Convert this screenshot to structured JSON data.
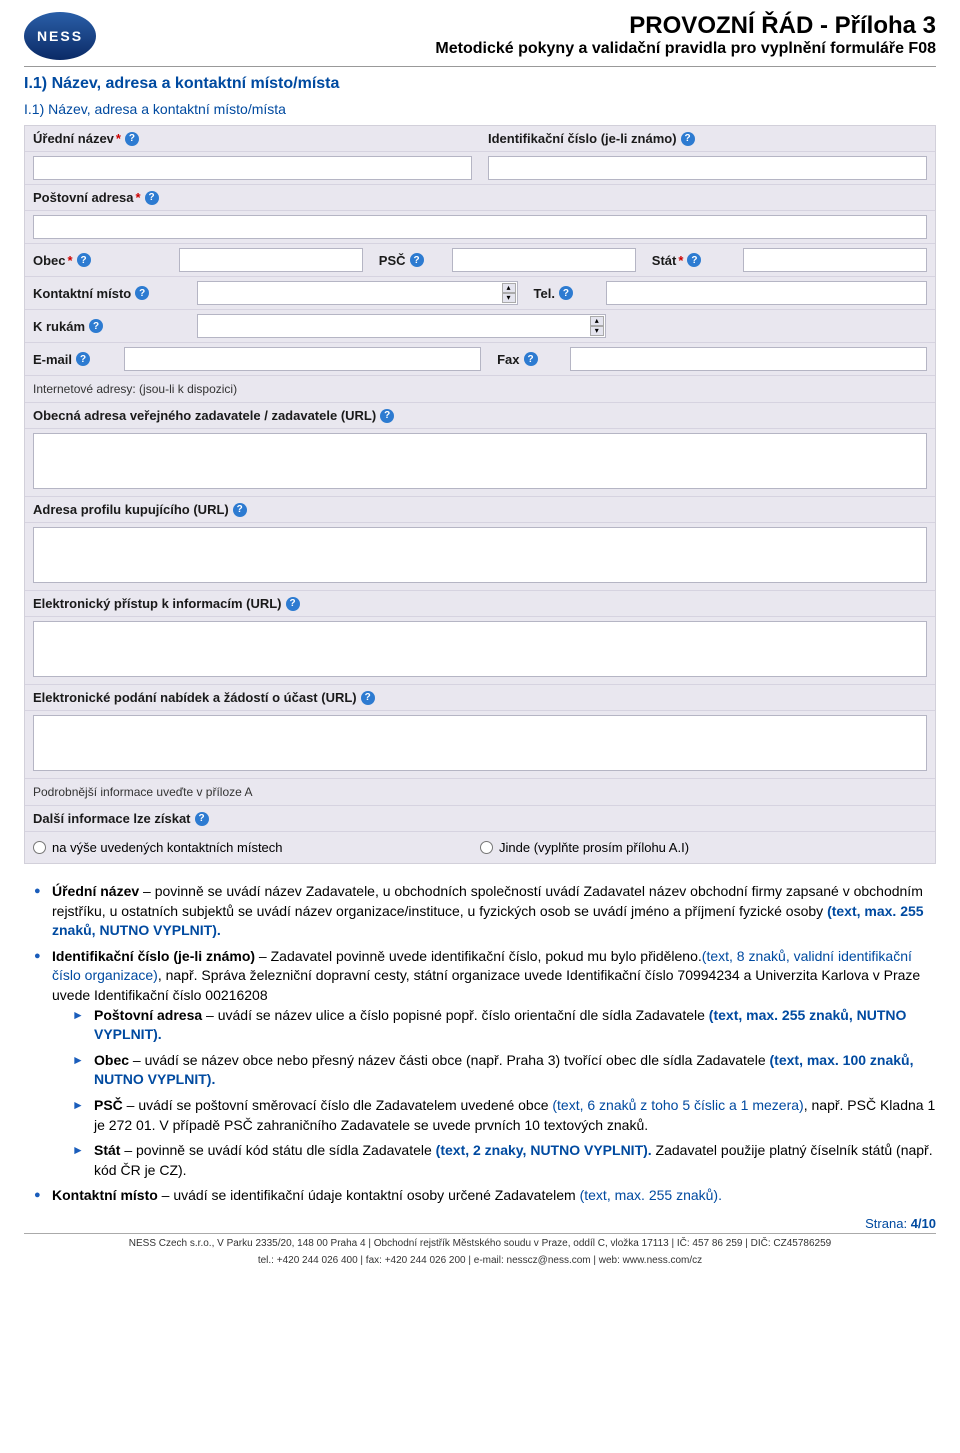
{
  "header": {
    "title": "PROVOZNÍ ŘÁD - Příloha 3",
    "subtitle": "Metodické pokyny a validační pravidla pro vyplnění formuláře F08"
  },
  "section": {
    "number": "I.1)",
    "title": "Název, adresa a kontaktní místo/místa",
    "subheading": "I.1) Název, adresa a kontaktní místo/místa"
  },
  "form": {
    "uredni_nazev": {
      "label": "Úřední název",
      "value": ""
    },
    "id_cislo": {
      "label": "Identifikační číslo (je-li známo)",
      "value": ""
    },
    "postovni_adresa": {
      "label": "Poštovní adresa",
      "value": ""
    },
    "obec": {
      "label": "Obec",
      "value": ""
    },
    "psc": {
      "label": "PSČ",
      "value": ""
    },
    "stat": {
      "label": "Stát",
      "value": ""
    },
    "kontaktni_misto": {
      "label": "Kontaktní místo",
      "value": ""
    },
    "tel": {
      "label": "Tel.",
      "value": ""
    },
    "k_rukam": {
      "label": "K rukám",
      "value": ""
    },
    "email": {
      "label": "E-mail",
      "value": ""
    },
    "fax": {
      "label": "Fax",
      "value": ""
    },
    "internetove_adresy": {
      "label": "Internetové adresy: (jsou-li k dispozici)"
    },
    "obecna_url": {
      "label": "Obecná adresa veřejného zadavatele / zadavatele (URL)",
      "value": ""
    },
    "profil_url": {
      "label": "Adresa profilu kupujícího (URL)",
      "value": ""
    },
    "el_pristup_url": {
      "label": "Elektronický přístup k informacím (URL)",
      "value": ""
    },
    "el_podani_url": {
      "label": "Elektronické podání nabídek a žádostí o účast (URL)",
      "value": ""
    },
    "podrobnejsi": "Podrobnější informace uveďte v příloze A",
    "dalsi_info": {
      "label": "Další informace lze získat",
      "opt1": "na výše uvedených kontaktních místech",
      "opt2": "Jinde (vyplňte prosím přílohu A.I)"
    }
  },
  "instr": {
    "b1_label": "Úřední název",
    "b1_text1": " – povinně se uvádí název Zadavatele, u obchodních společností uvádí Zadavatel název obchodní firmy zapsané v obchodním rejstříku, u ostatních subjektů se uvádí název organizace/instituce, u fyzických osob se uvádí jméno a příjmení fyzické osoby ",
    "b1_hint": "(text, max. 255 znaků, NUTNO VYPLNIT).",
    "b2_label": "Identifikační číslo (je-li známo)",
    "b2_text1": " – Zadavatel povinně uvede identifikační číslo, pokud mu bylo přiděleno.",
    "b2_hint": "(text, 8 znaků, validní identifikační číslo organizace)",
    "b2_text2": ", např. Správa železniční dopravní cesty, státní organizace uvede Identifikační číslo 70994234 a Univerzita Karlova v Praze uvede Identifikační číslo 00216208",
    "t1_label": "Poštovní adresa",
    "t1_text": " – uvádí se název ulice a číslo popisné popř. číslo orientační dle sídla Zadavatele ",
    "t1_hint": "(text, max. 255 znaků, NUTNO VYPLNIT).",
    "t2_label": "Obec",
    "t2_text": " – uvádí se název obce nebo přesný název části obce (např. Praha 3) tvořící obec dle sídla Zadavatele ",
    "t2_hint": "(text, max. 100 znaků, NUTNO VYPLNIT).",
    "t3_label": "PSČ",
    "t3_text1": " – uvádí se poštovní směrovací číslo dle Zadavatelem uvedené obce ",
    "t3_hint": "(text, 6 znaků z toho 5 číslic a 1 mezera)",
    "t3_text2": ", např. PSČ Kladna 1 je 272 01. V případě PSČ zahraničního Zadavatele se uvede prvních 10 textových znaků.",
    "t4_label": "Stát",
    "t4_text1": " – povinně se uvádí kód státu dle sídla Zadavatele ",
    "t4_hint": "(text, 2 znaky, NUTNO VYPLNIT).",
    "t4_text2": " Zadavatel použije platný číselník států (např. kód ČR je CZ).",
    "b3_label": "Kontaktní místo",
    "b3_text": " – uvádí se identifikační údaje kontaktní osoby určené Zadavatelem ",
    "b3_hint": "(text, max. 255 znaků)."
  },
  "footer": {
    "page_label": "Strana:",
    "page_value": "4/10",
    "line1": "NESS Czech s.r.o., V Parku 2335/20, 148 00 Praha 4 | Obchodní rejstřík Městského soudu v Praze, oddíl C, vložka 17113 | IČ: 457 86 259 | DIČ: CZ45786259",
    "line2": "tel.: +420 244 026 400 | fax: +420 244 026 200 | e-mail: nesscz@ness.com | web: www.ness.com/cz"
  }
}
